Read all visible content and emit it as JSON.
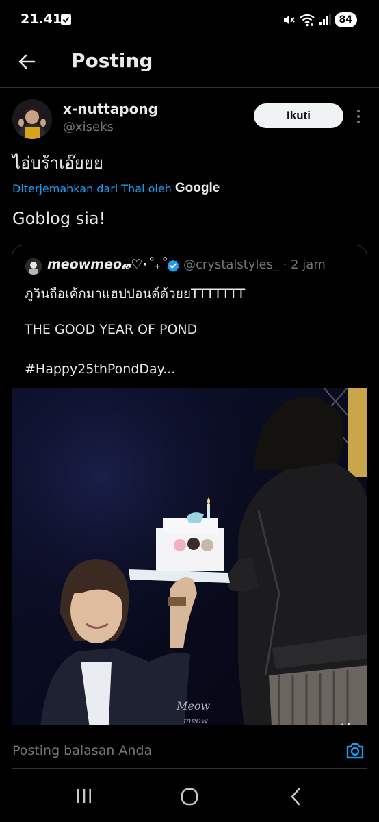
{
  "status_bar": {
    "time": "21.41",
    "battery": "84"
  },
  "app_bar": {
    "title": "Posting"
  },
  "post": {
    "author_name": "x-nuttapong",
    "author_handle": "@xiseks",
    "follow_label": "Ikuti",
    "text": "ไอ่บร้าเอ๊ยยย",
    "translated_label": "Diterjemahkan dari Thai oleh",
    "translated_by": "Google",
    "translation": "Goblog sia!"
  },
  "quote": {
    "name": "meowmeo𝓌♡·˚₊˚.",
    "handle_time": "@crystalstyles_ · 2 jam",
    "line1": "ภูวินถือเค้กมาแฮปปอนด์ด้วยยTTTTTTT",
    "line2": "THE GOOD YEAR OF POND",
    "line3": "#Happy25thPondDay..."
  },
  "reply": {
    "placeholder": "Posting balasan Anda"
  },
  "icons": {
    "back": "arrow-left-icon",
    "more": "more-vertical-icon",
    "verified": "verified-badge-icon",
    "volume": "volume-icon",
    "camera": "camera-icon",
    "recents": "recents-icon",
    "home": "home-icon",
    "nav_back": "nav-back-icon"
  },
  "colors": {
    "accent": "#1d9bf0",
    "background": "#000000",
    "text": "#e7e9ea",
    "muted": "#71767b"
  }
}
